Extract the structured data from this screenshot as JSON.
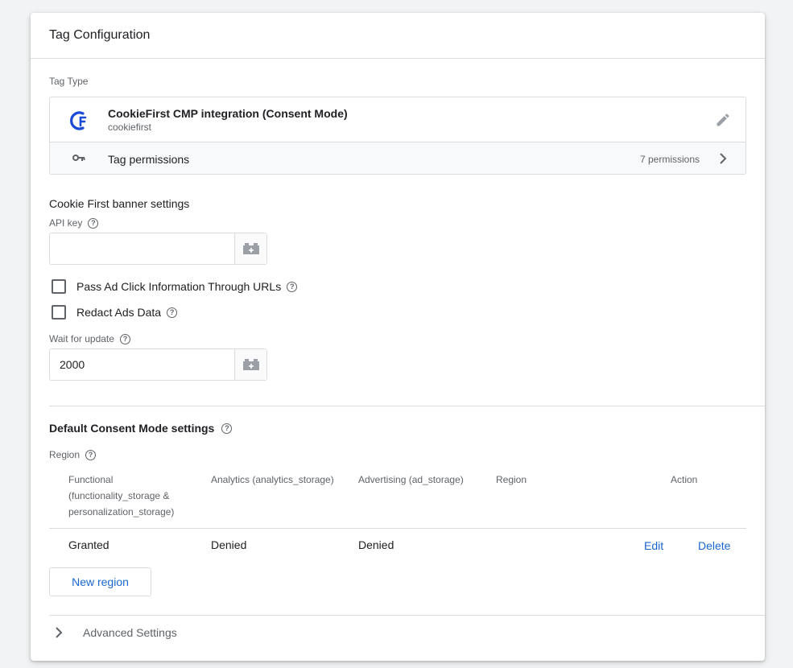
{
  "header": {
    "title": "Tag Configuration"
  },
  "tag_type": {
    "section_label": "Tag Type",
    "name": "CookieFirst CMP integration (Consent Mode)",
    "subtitle": "cookiefirst",
    "permissions_label": "Tag permissions",
    "permissions_count": "7 permissions"
  },
  "banner": {
    "title": "Cookie First banner settings",
    "api_key_label": "API key",
    "api_key_value": "",
    "pass_ad_click_label": "Pass Ad Click Information Through URLs",
    "redact_ads_label": "Redact Ads Data",
    "wait_label": "Wait for update",
    "wait_value": "2000"
  },
  "consent": {
    "title": "Default Consent Mode settings",
    "region_label": "Region",
    "columns": {
      "functional": [
        "Functional",
        "(functionality_storage &",
        "personalization_storage)"
      ],
      "analytics": "Analytics (analytics_storage)",
      "advertising": "Advertising (ad_storage)",
      "region": "Region",
      "action": "Action"
    },
    "rows": [
      {
        "functional": "Granted",
        "analytics": "Denied",
        "advertising": "Denied",
        "region": "",
        "edit": "Edit",
        "delete": "Delete"
      }
    ],
    "new_region_label": "New region"
  },
  "advanced": {
    "label": "Advanced Settings"
  },
  "colors": {
    "accent": "#1967d2",
    "logo": "#1a4ad6",
    "border": "#dadce0"
  }
}
